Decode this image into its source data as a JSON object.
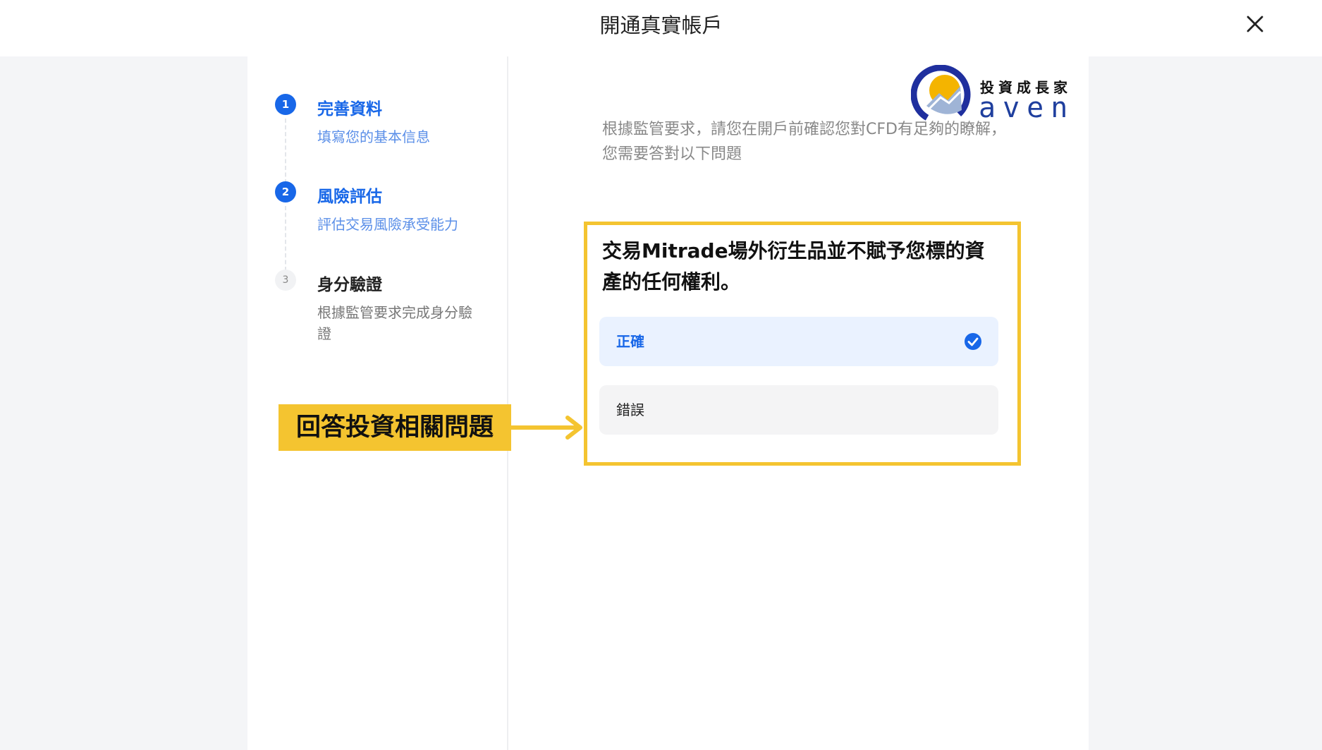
{
  "header": {
    "title": "開通真實帳戶"
  },
  "steps": [
    {
      "number": "1",
      "title": "完善資料",
      "subtitle": "填寫您的基本信息",
      "state": "active"
    },
    {
      "number": "2",
      "title": "風險評估",
      "subtitle": "評估交易風險承受能力",
      "state": "active"
    },
    {
      "number": "3",
      "title": "身分驗證",
      "subtitle": "根據監管要求完成身分驗證",
      "state": "inactive"
    }
  ],
  "logo": {
    "top_text": "投資成長家",
    "bottom_text": "aven"
  },
  "main": {
    "intro": "根據監管要求，請您在開戶前確認您對CFD有足夠的瞭解，您需要答對以下問題",
    "question": "交易Mitrade場外衍生品並不賦予您標的資產的任何權利。",
    "options": [
      {
        "label": "正確",
        "selected": true
      },
      {
        "label": "錯誤",
        "selected": false
      }
    ]
  },
  "annotation": {
    "label": "回答投資相關問題"
  },
  "colors": {
    "accent": "#1867e8",
    "highlight": "#f4c430"
  }
}
